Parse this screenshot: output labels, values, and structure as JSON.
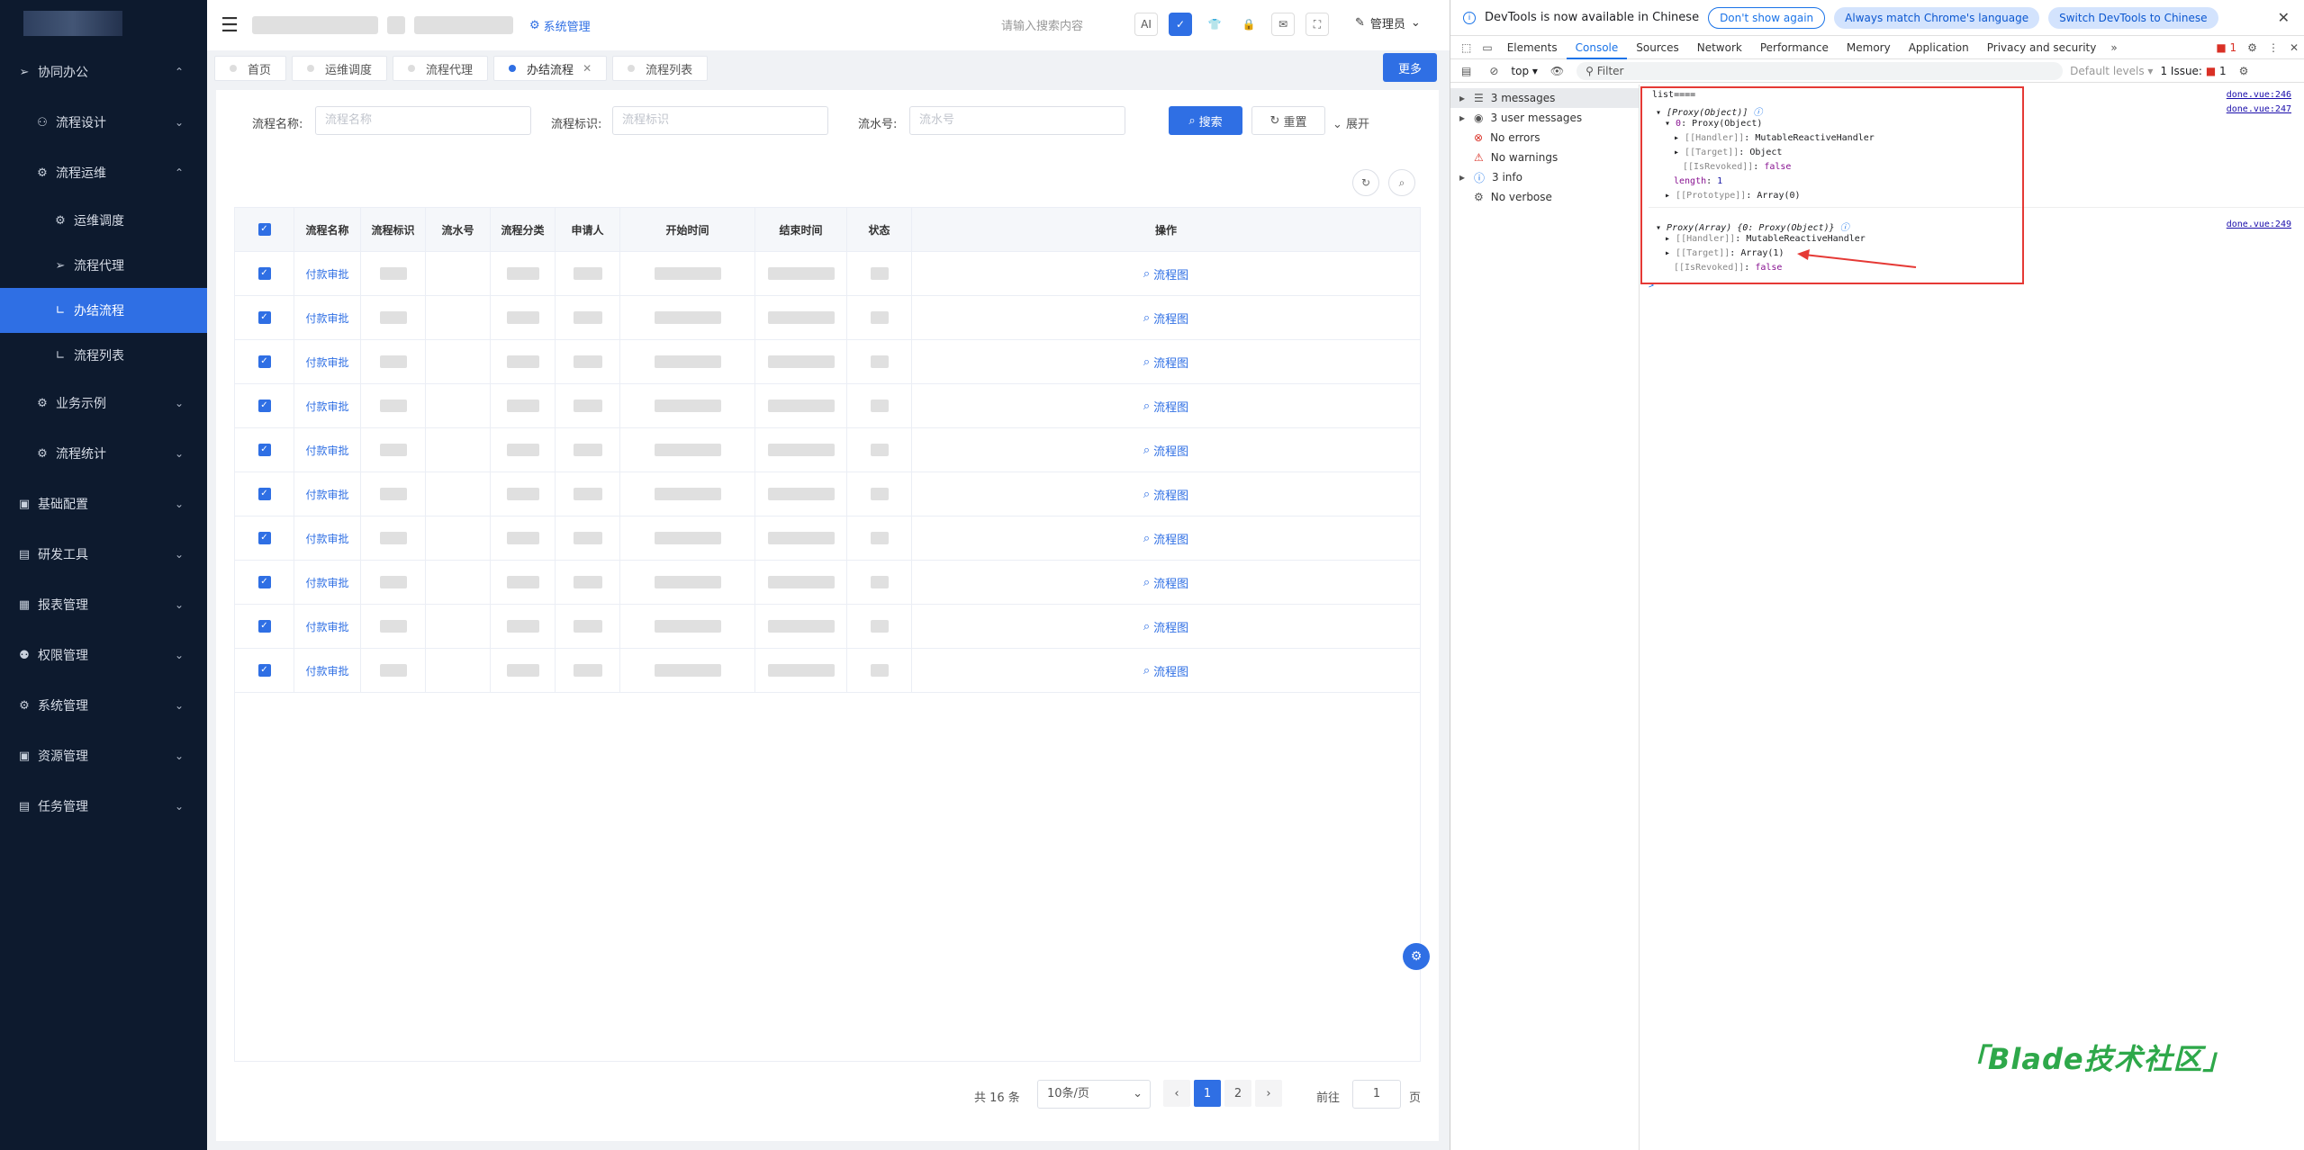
{
  "sidebar": {
    "items": [
      {
        "label": "协同办公",
        "icon": "arrow-right-icon",
        "level": 0,
        "arrow": "⌃"
      },
      {
        "label": "流程设计",
        "icon": "flow-icon",
        "level": 1,
        "arrow": "⌄"
      },
      {
        "label": "流程运维",
        "icon": "tool-icon",
        "level": 1,
        "arrow": "⌃"
      },
      {
        "label": "运维调度",
        "icon": "schedule-icon",
        "level": 2,
        "arrow": ""
      },
      {
        "label": "流程代理",
        "icon": "proxy-icon",
        "level": 2,
        "arrow": ""
      },
      {
        "label": "办结流程",
        "icon": "done-icon",
        "level": 2,
        "arrow": "",
        "active": true
      },
      {
        "label": "流程列表",
        "icon": "list-icon",
        "level": 2,
        "arrow": ""
      },
      {
        "label": "业务示例",
        "icon": "example-icon",
        "level": 1,
        "arrow": "⌄"
      },
      {
        "label": "流程统计",
        "icon": "stats-icon",
        "level": 1,
        "arrow": "⌄"
      },
      {
        "label": "基础配置",
        "icon": "config-icon",
        "level": 0,
        "arrow": "⌄"
      },
      {
        "label": "研发工具",
        "icon": "dev-tool-icon",
        "level": 0,
        "arrow": "⌄"
      },
      {
        "label": "报表管理",
        "icon": "report-icon",
        "level": 0,
        "arrow": "⌄"
      },
      {
        "label": "权限管理",
        "icon": "permission-icon",
        "level": 0,
        "arrow": "⌄"
      },
      {
        "label": "系统管理",
        "icon": "system-icon",
        "level": 0,
        "arrow": "⌄"
      },
      {
        "label": "资源管理",
        "icon": "resource-icon",
        "level": 0,
        "arrow": "⌄"
      },
      {
        "label": "任务管理",
        "icon": "task-icon",
        "level": 0,
        "arrow": "⌄"
      }
    ]
  },
  "header": {
    "sys_link": "系统管理",
    "search_placeholder": "请输入搜索内容",
    "ai_label": "AI",
    "admin": "管理员"
  },
  "tabs": {
    "items": [
      {
        "label": "首页",
        "active": false
      },
      {
        "label": "运维调度",
        "active": false
      },
      {
        "label": "流程代理",
        "active": false
      },
      {
        "label": "办结流程",
        "active": true,
        "closable": true
      },
      {
        "label": "流程列表",
        "active": false
      }
    ],
    "more": "更多"
  },
  "filter": {
    "name_label": "流程名称:",
    "name_placeholder": "流程名称",
    "key_label": "流程标识:",
    "key_placeholder": "流程标识",
    "serial_label": "流水号:",
    "serial_placeholder": "流水号",
    "search": "搜索",
    "reset": "重置",
    "expand": "展开"
  },
  "table": {
    "headers": [
      "流程名称",
      "流程标识",
      "流水号",
      "流程分类",
      "申请人",
      "开始时间",
      "结束时间",
      "状态",
      "操作"
    ],
    "rows": [
      {
        "name": "付款审批",
        "op": "流程图"
      },
      {
        "name": "付款审批",
        "op": "流程图"
      },
      {
        "name": "付款审批",
        "op": "流程图"
      },
      {
        "name": "付款审批",
        "op": "流程图"
      },
      {
        "name": "付款审批",
        "op": "流程图"
      },
      {
        "name": "付款审批",
        "op": "流程图"
      },
      {
        "name": "付款审批",
        "op": "流程图"
      },
      {
        "name": "付款审批",
        "op": "流程图"
      },
      {
        "name": "付款审批",
        "op": "流程图"
      },
      {
        "name": "付款审批",
        "op": "流程图"
      }
    ]
  },
  "pager": {
    "total": "共 16 条",
    "size": "10条/页",
    "pages": [
      "1",
      "2"
    ],
    "current": "1",
    "goto": "前往",
    "goto_value": "1",
    "unit": "页"
  },
  "devtools": {
    "banner": "DevTools is now available in Chinese",
    "btn_dont_show": "Don't show again",
    "btn_match": "Always match Chrome's language",
    "btn_switch": "Switch DevTools to Chinese",
    "tabs": [
      "Elements",
      "Console",
      "Sources",
      "Network",
      "Performance",
      "Memory",
      "Application",
      "Privacy and security"
    ],
    "active_tab": "Console",
    "err_count": "1",
    "context": "top",
    "filter_placeholder": "Filter",
    "levels": "Default levels",
    "issues": "1 Issue:",
    "issue_count": "1",
    "sidebar": [
      {
        "label": "3 messages",
        "icon": "list-icon"
      },
      {
        "label": "3 user messages",
        "icon": "user-icon"
      },
      {
        "label": "No errors",
        "icon": "error-icon"
      },
      {
        "label": "No warnings",
        "icon": "warning-icon"
      },
      {
        "label": "3 info",
        "icon": "info-icon"
      },
      {
        "label": "No verbose",
        "icon": "verbose-icon"
      }
    ],
    "console": {
      "l1": "list====",
      "l2": "[Proxy(Object)]",
      "l3_key": "0",
      "l3_val": "Proxy(Object)",
      "l4_key": "[[Handler]]",
      "l4_val": "MutableReactiveHandler",
      "l5_key": "[[Target]]",
      "l5_val": "Object",
      "l6_key": "[[IsRevoked]]",
      "l6_val": "false",
      "l7_key": "length",
      "l7_val": "1",
      "l8_key": "[[Prototype]]",
      "l8_val": "Array(0)",
      "l9": "Proxy(Array)  {0: Proxy(Object)}",
      "l10_key": "[[Handler]]",
      "l10_val": "MutableReactiveHandler",
      "l11_key": "[[Target]]",
      "l11_val": "Array(1)",
      "l12_key": "[[IsRevoked]]",
      "l12_val": "false",
      "src1": "done.vue:246",
      "src2": "done.vue:247",
      "src3": "done.vue:249",
      "prompt": ">"
    }
  },
  "watermark": "「Blade技术社区」",
  "colors": {
    "primary": "#2f6fe4",
    "sidebar_bg": "#0d1a2e",
    "annot_red": "#e53935",
    "watermark": "#2ea84a"
  }
}
